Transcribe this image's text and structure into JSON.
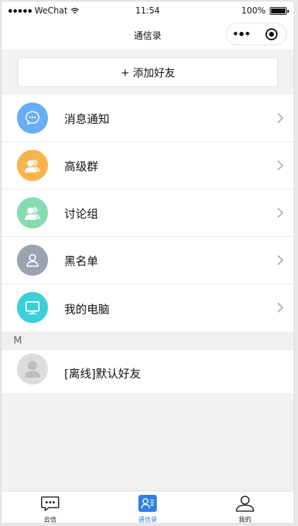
{
  "status_bar": {
    "carrier": "WeChat",
    "time": "11:54",
    "battery": "100%",
    "battery_level": 1.0
  },
  "navbar": {
    "title": "通信录"
  },
  "add_friend": {
    "label": "+ 添加好友"
  },
  "menu": {
    "items": [
      {
        "label": "消息通知",
        "icon": "chat-bubble-icon",
        "color": "#67aef5"
      },
      {
        "label": "高级群",
        "icon": "group-icon",
        "color": "#f7b44a"
      },
      {
        "label": "讨论组",
        "icon": "discussion-group-icon",
        "color": "#86dbb0"
      },
      {
        "label": "黑名单",
        "icon": "blacklist-user-icon",
        "color": "#9aa3b0"
      },
      {
        "label": "我的电脑",
        "icon": "computer-icon",
        "color": "#3ccfd7"
      }
    ]
  },
  "section": {
    "letter": "M"
  },
  "contacts": [
    {
      "label": "[离线]默认好友"
    }
  ],
  "tabbar": {
    "tabs": [
      {
        "label": "云信",
        "icon": "chat-dots-icon",
        "active": false
      },
      {
        "label": "通信录",
        "icon": "contacts-icon",
        "active": true
      },
      {
        "label": "我的",
        "icon": "profile-icon",
        "active": false
      }
    ],
    "active_color": "#2f7ee6"
  }
}
